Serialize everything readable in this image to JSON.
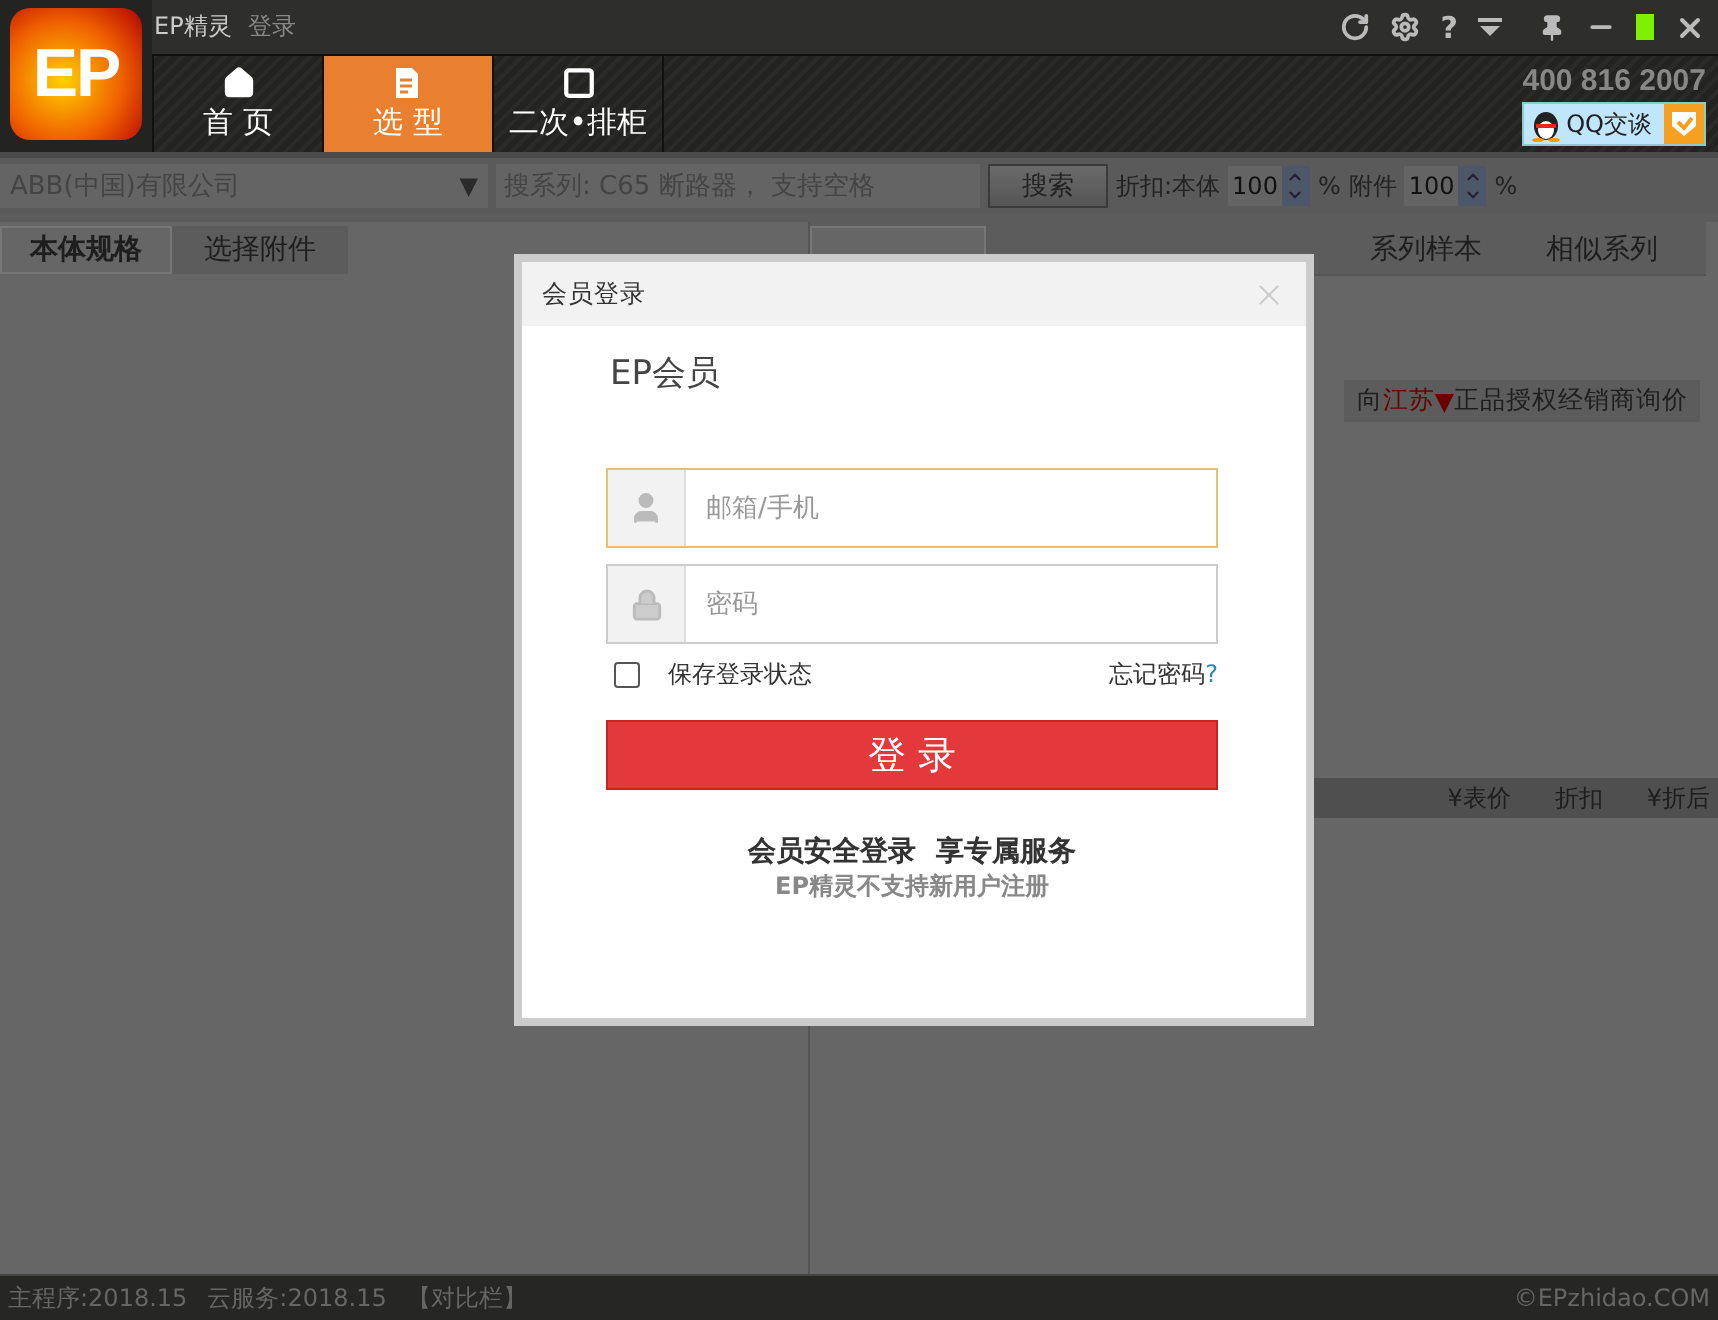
{
  "app": {
    "logo": "EP",
    "title": "EP精灵",
    "login_link": "登录",
    "help": "?"
  },
  "nav": [
    {
      "label": "首 页",
      "kind": "home",
      "selected": false
    },
    {
      "label": "选 型",
      "kind": "select",
      "selected": true
    },
    {
      "label": "二次•排柜",
      "kind": "cabinet",
      "selected": false
    }
  ],
  "hotline": "400 816 2007",
  "qq_button": "QQ交谈",
  "toolbar": {
    "brand_select": "ABB(中国)有限公司",
    "search": {
      "placeholder": "搜系列: C65 断路器， 支持空格"
    },
    "search_button": "搜索",
    "discount_label": "折扣:本体",
    "body_discount": "100",
    "percent_body": "%",
    "accessory_label": "附件",
    "accessory_discount": "100",
    "percent_accessory": "%"
  },
  "left_tabs": [
    {
      "label": "本体规格",
      "selected": true
    },
    {
      "label": "选择附件",
      "selected": false
    }
  ],
  "right_tabs": [
    {
      "selected": true
    },
    {
      "selected": false
    },
    {
      "selected": false
    },
    {
      "label": "系列样本",
      "selected": false
    },
    {
      "label": "相似系列",
      "selected": false
    }
  ],
  "inquiry": {
    "prefix": "向",
    "region": "江苏",
    "arrow": "▼",
    "suffix": "正品授权经销商询价"
  },
  "price_columns": [
    "¥表价",
    "折扣",
    "¥折后"
  ],
  "dialog": {
    "title": "会员登录",
    "heading": "EP会员",
    "email": {
      "placeholder": "邮箱/手机",
      "focused": true
    },
    "password": {
      "placeholder": "密码",
      "focused": false
    },
    "remember": {
      "label": "保存登录状态",
      "checked": false
    },
    "forgot": "忘记密码",
    "forgot_mark": "?",
    "submit": "登 录",
    "slogan": "会员安全登录  享专属服务",
    "note": "EP精灵不支持新用户注册"
  },
  "status": {
    "main": "主程序:2018.15",
    "cloud": "云服务:2018.15",
    "compare": "【对比栏】",
    "copyright": "©EPzhidao.COM"
  }
}
